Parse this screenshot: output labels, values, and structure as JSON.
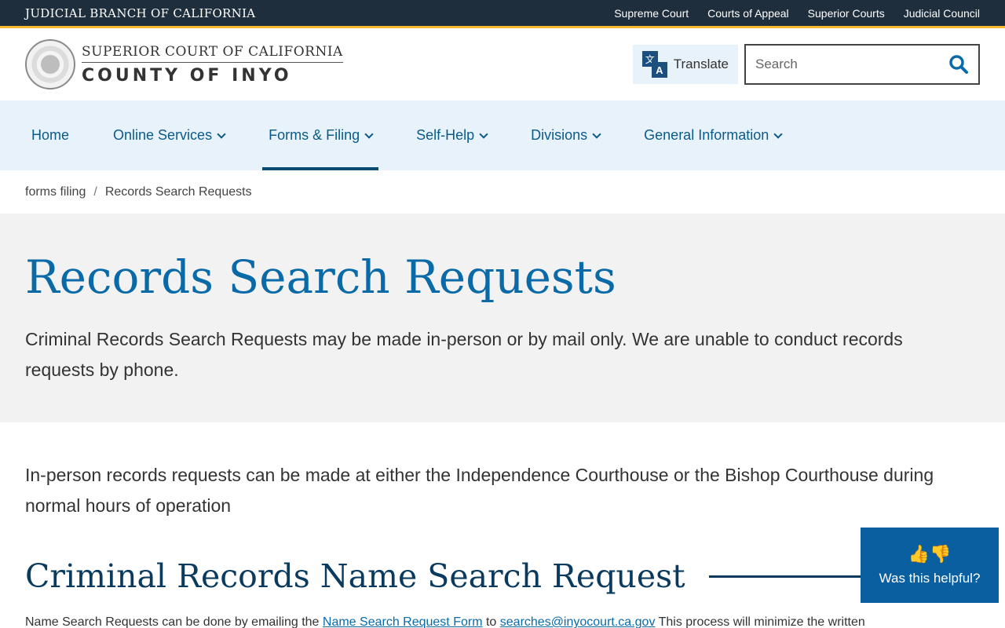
{
  "topbar": {
    "branch": "JUDICIAL BRANCH OF CALIFORNIA",
    "links": [
      "Supreme Court",
      "Courts of Appeal",
      "Superior Courts",
      "Judicial Council"
    ]
  },
  "header": {
    "court_line": "SUPERIOR COURT OF CALIFORNIA",
    "county_line": "COUNTY OF INYO",
    "translate_label": "Translate",
    "search_placeholder": "Search"
  },
  "nav": {
    "items": [
      {
        "label": "Home"
      },
      {
        "label": "Online Services"
      },
      {
        "label": "Forms & Filing"
      },
      {
        "label": "Self-Help"
      },
      {
        "label": "Divisions"
      },
      {
        "label": "General Information"
      }
    ]
  },
  "breadcrumb": {
    "parent": "forms filing",
    "separator": "/",
    "current": "Records Search Requests"
  },
  "hero": {
    "title": "Records Search Requests",
    "lead": "Criminal Records Search Requests may be made in-person or by mail only. We are unable to conduct records requests by phone."
  },
  "content": {
    "intro": "In-person records requests can be made at either the Independence Courthouse or the Bishop Courthouse during normal hours of operation",
    "section_title": "Criminal Records Name Search Request",
    "cut_text_start": "Name Search Requests can be done by emailing the ",
    "cut_link1": "Name Search Request Form",
    "cut_text_mid": " to ",
    "cut_link2": "searches@inyocourt.ca.gov",
    "cut_text_end": " This process will minimize the written"
  },
  "helpful": {
    "label": "Was this helpful?"
  }
}
